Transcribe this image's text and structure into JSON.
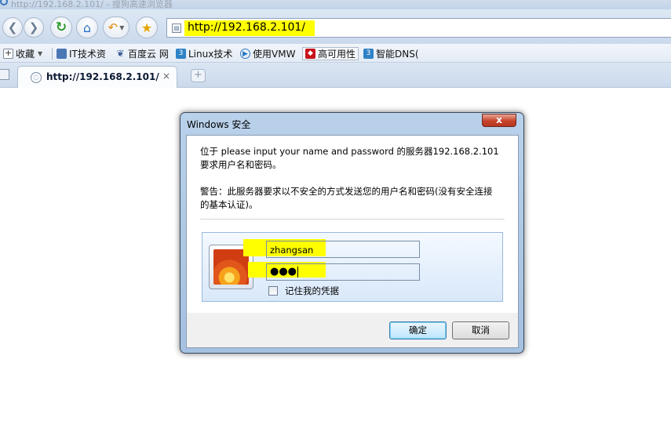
{
  "browser": {
    "window_title": "http://192.168.2.101/ - 搜狗高速浏览器",
    "address": "http://192.168.2.101/",
    "toolbar": {
      "back_icon": "back-arrow-icon",
      "forward_icon": "forward-arrow-icon",
      "refresh_icon": "refresh-icon",
      "home_icon": "home-icon",
      "undo_icon": "undo-icon",
      "favorite_icon": "star-icon"
    },
    "bookmarks": {
      "favorites_label": "收藏",
      "items": [
        "IT技术资",
        "百度云 网",
        "Linux技术",
        "使用VMW",
        "高可用性",
        "智能DNS("
      ]
    },
    "tab": {
      "label": "http://192.168.2.101/",
      "close": "×",
      "new_tab": "+"
    }
  },
  "dialog": {
    "title": "Windows 安全",
    "close_label": "x",
    "message_line1": "位于 please input your name and password 的服务器192.168.2.101",
    "message_line2": "要求用户名和密码。",
    "warning_line1": "警告：此服务器要求以不安全的方式发送您的用户名和密码(没有安全连接",
    "warning_line2": "的基本认证)。",
    "username_value": "zhangsan",
    "password_masked": "●●●",
    "remember_label": "记住我的凭据",
    "remember_checked": false,
    "ok_label": "确定",
    "cancel_label": "取消"
  },
  "colors": {
    "highlight": "#ffff00",
    "dialog_frame": "#b9d1ea",
    "close_button": "#c7432b"
  }
}
